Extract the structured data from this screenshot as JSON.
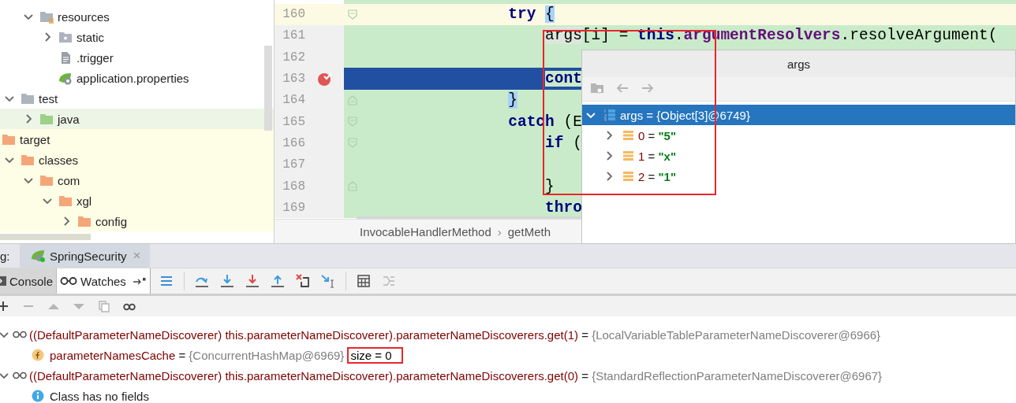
{
  "project_tree": {
    "items": [
      {
        "children": [
          {
            "children": [
              {
                "label": "resources",
                "kind": "resource-folder",
                "expanded": true,
                "selected": false,
                "children": [
                  {
                    "label": "static",
                    "kind": "web-folder",
                    "expanded": false,
                    "selected": false
                  },
                  {
                    "label": ".trigger",
                    "kind": "text-file",
                    "selected": false
                  },
                  {
                    "label": "application.properties",
                    "kind": "spring-file",
                    "selected": false
                  }
                ]
              }
            ]
          },
          {
            "label": "test",
            "kind": "folder",
            "expanded": true,
            "selected": false,
            "children": [
              {
                "label": "java",
                "kind": "test-source-folder",
                "expanded": false,
                "selected": true
              }
            ]
          }
        ]
      },
      {
        "label": "target",
        "kind": "excluded-folder",
        "selected": false,
        "children": [
          {
            "label": "classes",
            "kind": "excluded-folder",
            "expanded": true,
            "selected": false,
            "children": [
              {
                "label": "com",
                "kind": "excluded-folder",
                "expanded": true,
                "selected": false,
                "children": [
                  {
                    "label": "xgl",
                    "kind": "excluded-folder",
                    "expanded": true,
                    "selected": false,
                    "children": [
                      {
                        "label": "config",
                        "kind": "excluded-folder",
                        "expanded": false,
                        "selected": false
                      }
                    ]
                  }
                ]
              }
            ]
          }
        ]
      }
    ]
  },
  "editor": {
    "lines": [
      {
        "number": "160",
        "kind": "caret",
        "fold_start": true,
        "tokens": [
          {
            "text": "                try ",
            "kind": "keyword"
          },
          {
            "text": "{",
            "kind": "brace"
          }
        ]
      },
      {
        "number": "161",
        "kind": "changed",
        "tokens": [
          {
            "text": "                    args",
            "kind": "usage"
          },
          {
            "text": "[i] = ",
            "kind": "plain"
          },
          {
            "text": "this",
            "kind": "keyword"
          },
          {
            "text": ".",
            "kind": "plain"
          },
          {
            "text": "argumentResolvers",
            "kind": "field"
          },
          {
            "text": ".resolveArgument(",
            "kind": "plain"
          }
        ]
      },
      {
        "number": "162",
        "kind": "changed"
      },
      {
        "number": "163",
        "kind": "execution",
        "breakpoint": true,
        "tokens": [
          {
            "text": "                    cont",
            "kind": "keyword"
          }
        ]
      },
      {
        "number": "164",
        "kind": "changed",
        "fold_end": true,
        "tokens": [
          {
            "text": "                }",
            "kind": "brace"
          }
        ]
      },
      {
        "number": "165",
        "kind": "changed",
        "fold_start": true,
        "tokens": [
          {
            "text": "                catch",
            "kind": "keyword"
          },
          {
            "text": " (E",
            "kind": "plain"
          }
        ]
      },
      {
        "number": "166",
        "kind": "changed",
        "fold_start": true,
        "tokens": [
          {
            "text": "                    if",
            "kind": "keyword"
          },
          {
            "text": " (",
            "kind": "plain"
          }
        ]
      },
      {
        "number": "167",
        "kind": "changed"
      },
      {
        "number": "168",
        "kind": "changed",
        "fold_end": true,
        "tokens": [
          {
            "text": "                    }",
            "kind": "plain"
          }
        ]
      },
      {
        "number": "169",
        "kind": "changed",
        "tokens": [
          {
            "text": "                    thro",
            "kind": "keyword"
          }
        ]
      }
    ],
    "breadcrumb": {
      "items": [
        "InvocableHandlerMethod",
        "getMeth"
      ],
      "separator": "›"
    },
    "annotation_frame": true
  },
  "popup": {
    "title": "args",
    "assign": "=",
    "toolbar": [
      {
        "kind": "folder",
        "disabled": true
      },
      {
        "kind": "back",
        "disabled": true
      },
      {
        "kind": "forward",
        "disabled": true
      }
    ],
    "tree": [
      {
        "name": "args",
        "value": "{Object[3]@6749}",
        "kind": "array",
        "expanded": true,
        "selected": true,
        "children": [
          {
            "name": "0",
            "value": "\"5\"",
            "kind": "field",
            "expanded": false,
            "selected": false
          },
          {
            "name": "1",
            "value": "\"x\"",
            "kind": "field",
            "expanded": false,
            "selected": false
          },
          {
            "name": "2",
            "value": "\"1\"",
            "kind": "field",
            "expanded": false,
            "selected": false
          }
        ]
      }
    ]
  },
  "debug": {
    "label": "g:",
    "tabs": [
      {
        "label": "SpringSecurity",
        "selected": true,
        "close": "×"
      }
    ],
    "views": [
      {
        "label": "Console",
        "selected": false
      },
      {
        "label": "Watches",
        "selected": true
      }
    ],
    "toolbar": [
      {
        "kind": "layout"
      },
      {
        "kind": "separator"
      },
      {
        "kind": "step-over"
      },
      {
        "kind": "step-into"
      },
      {
        "kind": "force-step-into"
      },
      {
        "kind": "step-out"
      },
      {
        "kind": "drop-frame"
      },
      {
        "kind": "run-to-cursor"
      },
      {
        "kind": "separator"
      },
      {
        "kind": "evaluate"
      },
      {
        "kind": "trace",
        "disabled": true
      }
    ],
    "watch_toolbar": [
      {
        "kind": "add",
        "disabled": false
      },
      {
        "kind": "remove",
        "disabled": true
      },
      {
        "kind": "up",
        "disabled": true
      },
      {
        "kind": "down",
        "disabled": true
      },
      {
        "kind": "copy",
        "disabled": true
      },
      {
        "kind": "watch",
        "disabled": false
      }
    ],
    "assign": "=",
    "watches": [
      {
        "expression": "((DefaultParameterNameDiscoverer) this.parameterNameDiscoverer).parameterNameDiscoverers.get(1)",
        "value": "{LocalVariableTableParameterNameDiscoverer@6966}",
        "expanded": true,
        "children": [
          {
            "kind": "field",
            "name": "parameterNamesCache",
            "value": "{ConcurrentHashMap@6969}",
            "extra": "size = 0",
            "boxed": true
          }
        ]
      },
      {
        "expression": "((DefaultParameterNameDiscoverer) this.parameterNameDiscoverer).parameterNameDiscoverers.get(0)",
        "value": "{StandardReflectionParameterNameDiscoverer@6967}",
        "expanded": true,
        "children": [
          {
            "kind": "info",
            "text": "Class has no fields"
          }
        ]
      }
    ]
  }
}
